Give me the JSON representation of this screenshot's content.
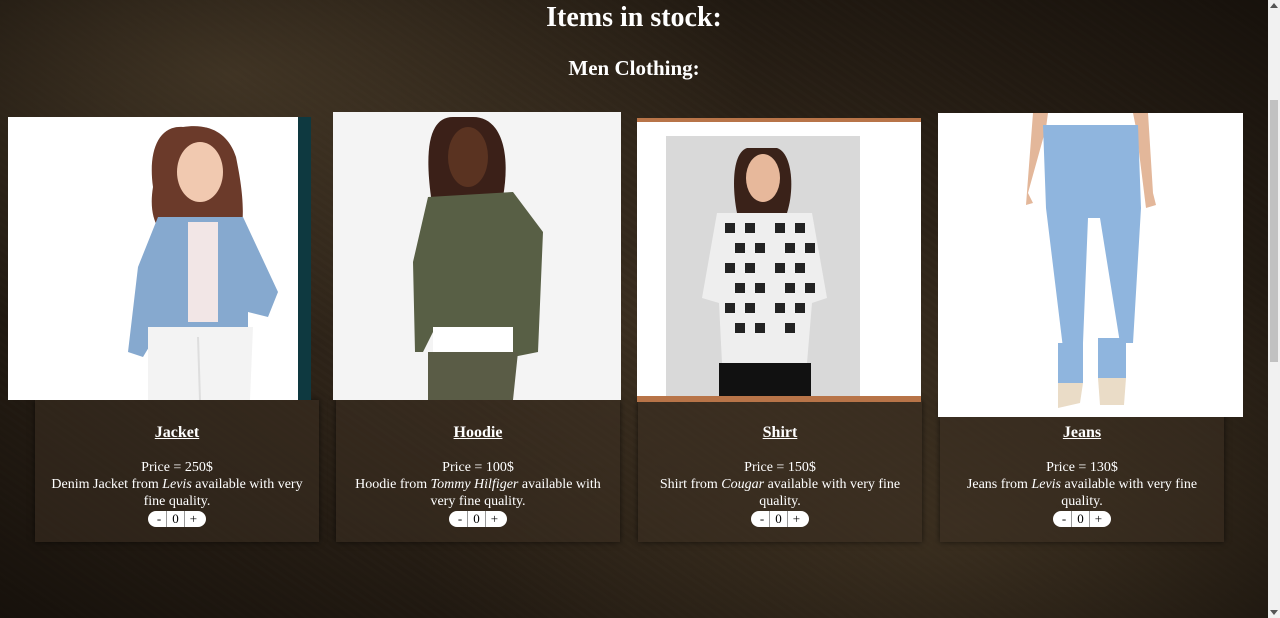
{
  "page": {
    "title": "Items in stock:",
    "section": "Men Clothing:"
  },
  "products": [
    {
      "name": "Jacket",
      "price": "Price = 250$",
      "desc_pre": "Denim Jacket from ",
      "brand": "Levis",
      "desc_post": " available with very fine quality.",
      "qty": "0",
      "minus": "-",
      "plus": "+"
    },
    {
      "name": "Hoodie",
      "price": "Price = 100$",
      "desc_pre": "Hoodie from ",
      "brand": "Tommy Hilfiger",
      "desc_post": " available with very fine quality.",
      "qty": "0",
      "minus": "-",
      "plus": "+"
    },
    {
      "name": "Shirt",
      "price": "Price = 150$",
      "desc_pre": "Shirt from ",
      "brand": "Cougar",
      "desc_post": " available with very fine quality.",
      "qty": "0",
      "minus": "-",
      "plus": "+"
    },
    {
      "name": "Jeans",
      "price": "Price = 130$",
      "desc_pre": "Jeans from ",
      "brand": "Levis",
      "desc_post": " available with very fine quality.",
      "qty": "0",
      "minus": "-",
      "plus": "+"
    }
  ]
}
